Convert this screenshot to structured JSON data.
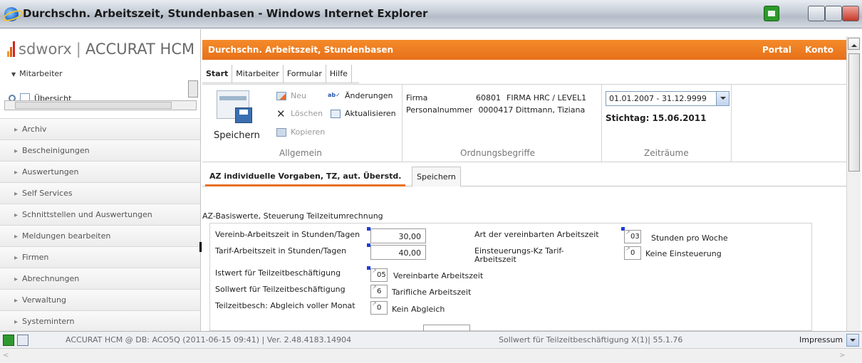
{
  "window": {
    "title": "Durchschn. Arbeitszeit, Stundenbasen - Windows Internet Explorer"
  },
  "sidebar": {
    "logo_brand": "sdworx",
    "logo_product": "ACCURAT HCM",
    "section": "Mitarbeiter",
    "tree_item": "Übersicht",
    "items": [
      {
        "label": "Archiv"
      },
      {
        "label": "Bescheinigungen"
      },
      {
        "label": "Auswertungen"
      },
      {
        "label": "Self Services"
      },
      {
        "label": "Schnittstellen und Auswertungen"
      },
      {
        "label": "Meldungen bearbeiten"
      },
      {
        "label": "Firmen"
      },
      {
        "label": "Abrechnungen"
      },
      {
        "label": "Verwaltung"
      },
      {
        "label": "Systemintern"
      }
    ]
  },
  "header": {
    "page_title": "Durchschn. Arbeitszeit, Stundenbasen",
    "portal": "Portal",
    "konto": "Konto"
  },
  "menu_tabs": [
    {
      "label": "Start"
    },
    {
      "label": "Mitarbeiter"
    },
    {
      "label": "Formular"
    },
    {
      "label": "Hilfe"
    }
  ],
  "ribbon": {
    "save": "Speichern",
    "neu": "Neu",
    "loeschen": "Löschen",
    "kopieren": "Kopieren",
    "aenderungen": "Änderungen",
    "aktualisieren": "Aktualisieren",
    "group_allgemein": "Allgemein",
    "group_ordnung": "Ordnungsbegriffe",
    "group_zeitraeume": "Zeiträume",
    "firma_label": "Firma",
    "firma_nr": "60801",
    "firma_name": "FIRMA HRC / LEVEL1",
    "personal_label": "Personalnummer",
    "personal_value": "0000417 Dittmann, Tiziana",
    "period": "01.01.2007 - 31.12.9999",
    "stichtag": "Stichtag: 15.06.2011"
  },
  "sub_tabs": [
    {
      "label": "AZ individuelle Vorgaben, TZ, aut. Überstd."
    },
    {
      "label": "Speichern"
    }
  ],
  "form": {
    "section_title": "AZ-Basiswerte, Steuerung Teilzeitumrechnung",
    "vereinb_label": "Vereinb-Arbeitszeit in Stunden/Tagen",
    "vereinb_value": "30,00",
    "tarif_label": "Tarif-Arbeitszeit in Stunden/Tagen",
    "tarif_value": "40,00",
    "art_label": "Art der vereinbarten Arbeitszeit",
    "art_code": "03",
    "art_text": "Stunden pro Woche",
    "einst_label_1": "Einsteuerungs-Kz Tarif-",
    "einst_label_2": "Arbeitszeit",
    "einst_code": "0",
    "einst_text": "Keine Einsteuerung",
    "istwert_label": "Istwert für Teilzeitbeschäftigung",
    "istwert_code": "05",
    "istwert_text": "Vereinbarte Arbeitszeit",
    "sollwert_label": "Sollwert für Teilzeitbeschäftigung",
    "sollwert_code": "6",
    "sollwert_text": "Tarifliche Arbeitszeit",
    "abgleich_label": "Teilzeitbesch: Abgleich voller Monat",
    "abgleich_code": "0",
    "abgleich_text": "Kein Abgleich"
  },
  "status": {
    "db": "ACCURAT HCM @ DB: ACO5Q (2011-06-15 09:41) | Ver. 2.48.4183.14904",
    "field": "Sollwert für Teilzeitbeschäftigung X(1)| 55.1.76",
    "impressum": "Impressum"
  },
  "colors": {
    "accent_orange": "#e7701a",
    "required_marker": "#1a3fd8"
  }
}
